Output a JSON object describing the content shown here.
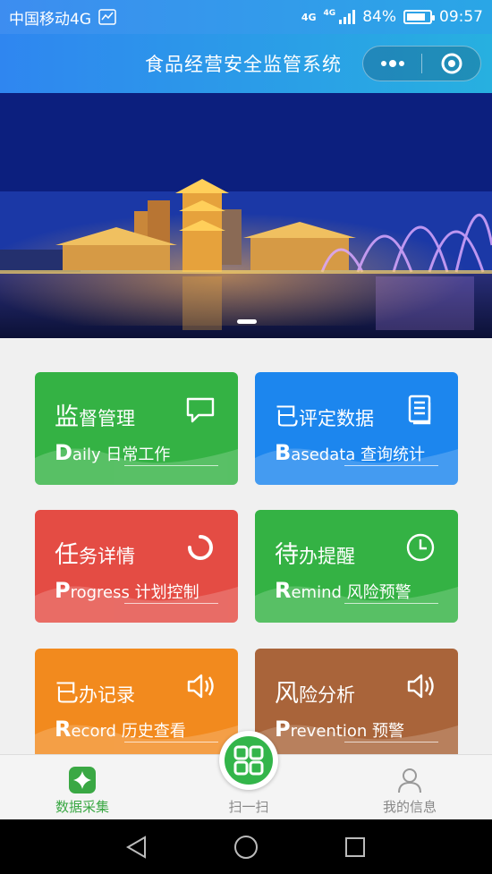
{
  "status_bar": {
    "carrier": "中国移动4G",
    "net_label_1": "4G",
    "net_label_2": "4G",
    "battery": "84%",
    "battery_level": 0.84,
    "time": "09:57"
  },
  "nav": {
    "title": "食品经营安全监管系统",
    "more_icon": "more-dots-icon",
    "close_icon": "target-icon"
  },
  "banner": {
    "image": "night-city-lake-fountain",
    "slide_count": 1,
    "active_slide": 1
  },
  "cards": [
    {
      "title_big": "监",
      "title_rest": "督管理",
      "sub_cap": "D",
      "sub_rest": "aily 日常工作",
      "icon": "chat-icon",
      "color": "#34b244"
    },
    {
      "title_big": "已",
      "title_rest": "评定数据",
      "sub_cap": "B",
      "sub_rest": "asedata 查询统计",
      "icon": "document-icon",
      "color": "#1c86ee"
    },
    {
      "title_big": "任",
      "title_rest": "务详情",
      "sub_cap": "P",
      "sub_rest": "rogress 计划控制",
      "icon": "loading-icon",
      "color": "#e44c44"
    },
    {
      "title_big": "待",
      "title_rest": "办提醒",
      "sub_cap": "R",
      "sub_rest": "emind 风险预警",
      "icon": "clock-icon",
      "color": "#34b244"
    },
    {
      "title_big": "已",
      "title_rest": "办记录",
      "sub_cap": "R",
      "sub_rest": "ecord 历史查看",
      "icon": "speaker-icon",
      "color": "#f28a1e"
    },
    {
      "title_big": "风",
      "title_rest": "险分析",
      "sub_cap": "P",
      "sub_rest": "revention 预警",
      "icon": "speaker-icon",
      "color": "#a9643a"
    }
  ],
  "tabbar": {
    "items": [
      {
        "label": "数据采集",
        "icon": "clover-icon",
        "active": true,
        "color": "#3aa844"
      },
      {
        "label": "扫一扫",
        "icon": "scan-grid-icon",
        "active": false,
        "color": "#888888"
      },
      {
        "label": "我的信息",
        "icon": "user-icon",
        "active": false,
        "color": "#888888"
      }
    ]
  },
  "system_nav": {
    "back_icon": "back-triangle-icon",
    "home_icon": "home-circle-icon",
    "recent_icon": "recent-square-icon"
  }
}
